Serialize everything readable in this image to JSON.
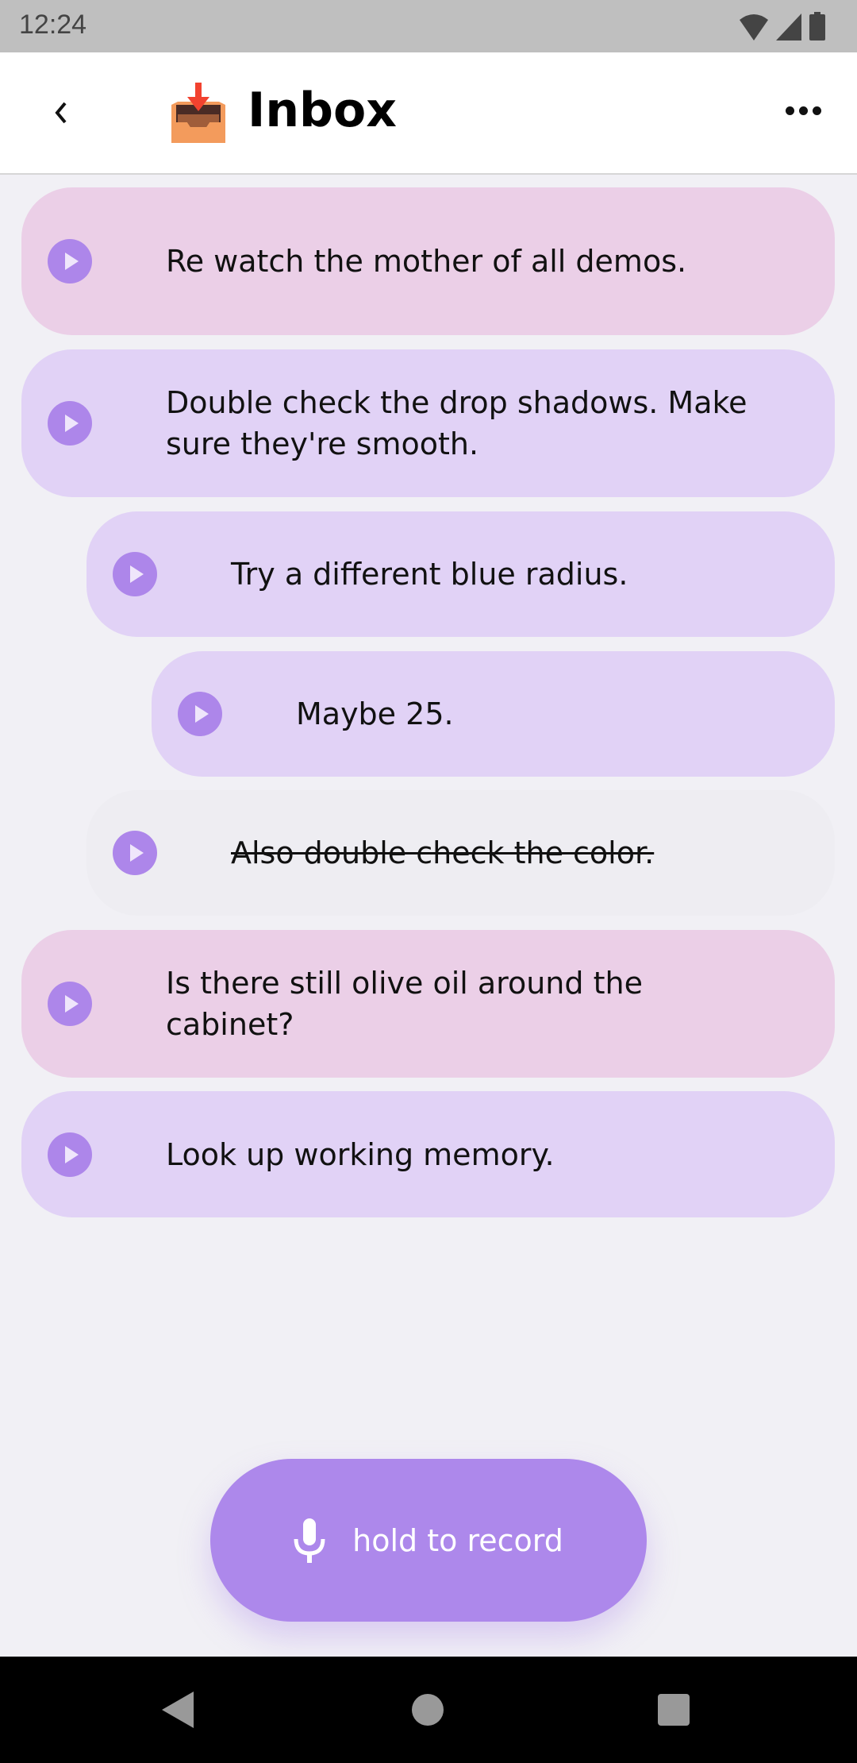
{
  "status_bar": {
    "time": "12:24",
    "icons": [
      "wifi-icon",
      "signal-icon",
      "battery-icon"
    ]
  },
  "header": {
    "title": "Inbox",
    "emoji": "inbox-tray",
    "back_icon": "chevron-left-icon",
    "menu_icon": "more-horizontal-icon"
  },
  "notes": [
    {
      "text": "Re watch the mother of all demos.",
      "color": "#ebcfe7",
      "indent": 0,
      "done": false
    },
    {
      "text": "Double check the drop shadows. Make sure they're smooth.",
      "color": "#e1d2f6",
      "indent": 0,
      "done": false
    },
    {
      "text": "Try a different blue radius.",
      "color": "#e1d2f6",
      "indent": 1,
      "done": false
    },
    {
      "text": "Maybe 25.",
      "color": "#e1d2f6",
      "indent": 2,
      "done": false
    },
    {
      "text": "Also double check the color.",
      "color": "#eeedf2",
      "indent": 1,
      "done": true
    },
    {
      "text": "Is there still olive oil around the cabinet?",
      "color": "#ebcfe7",
      "indent": 0,
      "done": false
    },
    {
      "text": "Look up working memory.",
      "color": "#e1d2f6",
      "indent": 0,
      "done": false
    }
  ],
  "record_button": {
    "label": "hold to record",
    "icon": "microphone-icon",
    "color": "#ad88eb"
  },
  "nav_bar": {
    "icons": [
      "back-triangle-icon",
      "home-circle-icon",
      "recents-square-icon"
    ]
  }
}
